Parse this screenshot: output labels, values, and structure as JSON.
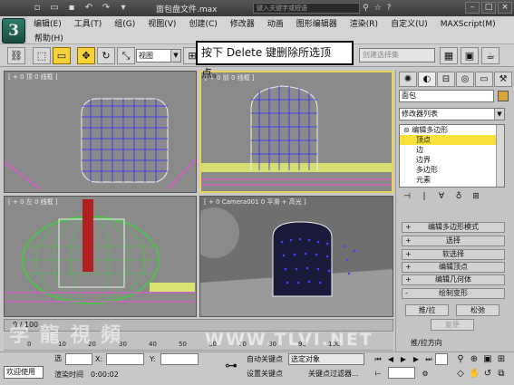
{
  "window": {
    "title": "面包盘文件.max",
    "search_placeholder": "键入关键字或短语",
    "controls": [
      "–",
      "□",
      "×"
    ],
    "app_logo": "3",
    "quick_access_icons": [
      "new-icon",
      "open-icon",
      "save-icon",
      "undo-icon",
      "redo-icon",
      "dropdown-icon"
    ]
  },
  "menu": {
    "items": [
      "编辑(E)",
      "工具(T)",
      "组(G)",
      "视图(V)",
      "创建(C)",
      "修改器",
      "动画",
      "图形编辑器",
      "渲染(R)",
      "自定义(U)",
      "MAXScript(M)"
    ],
    "help": "帮助(H)"
  },
  "toolbar": {
    "view_select": "视图",
    "selection_set_placeholder": "创建选择集"
  },
  "callout": {
    "text": "按下 Delete 键删除所选顶点。"
  },
  "viewports": {
    "top": {
      "label": "[ + 0 顶 0 线框 ]"
    },
    "front": {
      "label": "[ + 0 前 0 线框 ]"
    },
    "left": {
      "label": "[ + 0 左 0 线框 ]"
    },
    "camera": {
      "label": "[ + 0 Camera001 0 平滑 + 高光 ]"
    }
  },
  "command_panel": {
    "object_name": "面包",
    "object_color": "#d8a53c",
    "modifier_list": "修改器列表",
    "stack": [
      {
        "label": "编辑多边形",
        "level": "top"
      },
      {
        "label": "顶点",
        "level": "sub",
        "selected": true
      },
      {
        "label": "边",
        "level": "sub"
      },
      {
        "label": "边界",
        "level": "sub"
      },
      {
        "label": "多边形",
        "level": "sub"
      },
      {
        "label": "元素",
        "level": "sub"
      }
    ],
    "rollouts": [
      {
        "sign": "+",
        "label": "编辑多边形模式"
      },
      {
        "sign": "+",
        "label": "选择"
      },
      {
        "sign": "+",
        "label": "软选择"
      },
      {
        "sign": "+",
        "label": "编辑顶点"
      },
      {
        "sign": "+",
        "label": "编辑几何体"
      },
      {
        "sign": "-",
        "label": "绘制变形"
      }
    ],
    "push_pull": "推/拉",
    "relax": "松弛",
    "revert": "复原",
    "push_pull_direction": "推/拉方向"
  },
  "timeline": {
    "frame": "0 / 100",
    "ruler": [
      "0",
      "10",
      "20",
      "30",
      "40",
      "50",
      "60",
      "70",
      "80",
      "90",
      "100"
    ]
  },
  "status": {
    "welcome": "欢迎使用",
    "select_label": "选",
    "x_label": "X:",
    "y_label": "Y:",
    "render_time_label": "渲染时间",
    "render_time": "0:00:02",
    "auto_key": "自动关键点",
    "set_key": "设置关键点",
    "key_mode_select": "选定对象",
    "key_filters": "关键点过滤器..."
  },
  "watermarks": {
    "left": "学 龍 視 頻",
    "right": "WWW.TLVI.NET"
  }
}
